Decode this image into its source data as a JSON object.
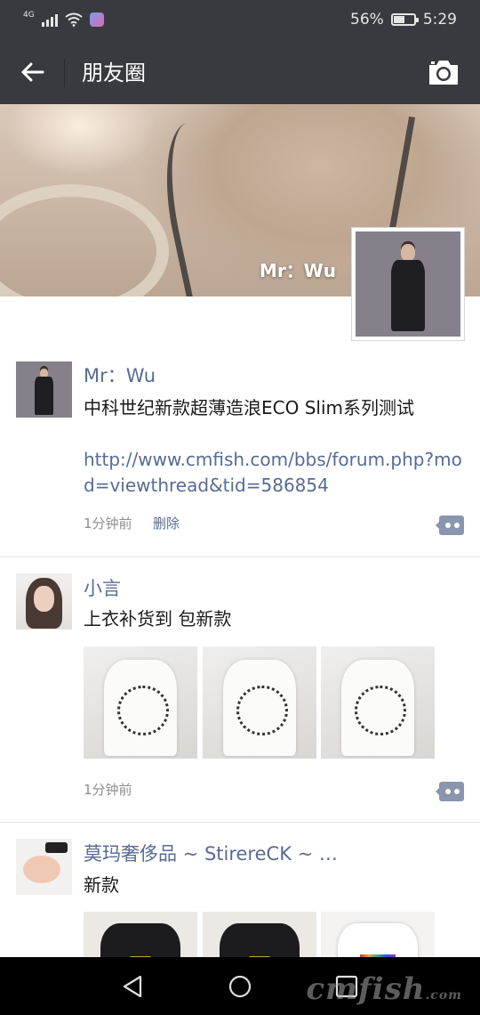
{
  "status_bar": {
    "network": "4G",
    "battery_text": "56%",
    "battery_level": 0.56,
    "time": "5:29"
  },
  "header": {
    "title": "朋友圈"
  },
  "cover": {
    "name": "Mr：Wu"
  },
  "moments": [
    {
      "nickname": "Mr：Wu",
      "text": "中科世纪新款超薄造浪ECO Slim系列测试",
      "link": "http://www.cmfish.com/bbs/forum.php?mod=viewthread&tid=586854",
      "time": "1分钟前",
      "delete_label": "删除"
    },
    {
      "nickname": "小言",
      "text": "上衣补货到 包新款",
      "time": "1分钟前"
    },
    {
      "nickname": "莫玛奢侈品 ~ StirereCK ~ …",
      "text": "新款"
    }
  ],
  "watermark": {
    "main": "cmfish",
    "suffix": ".com"
  }
}
